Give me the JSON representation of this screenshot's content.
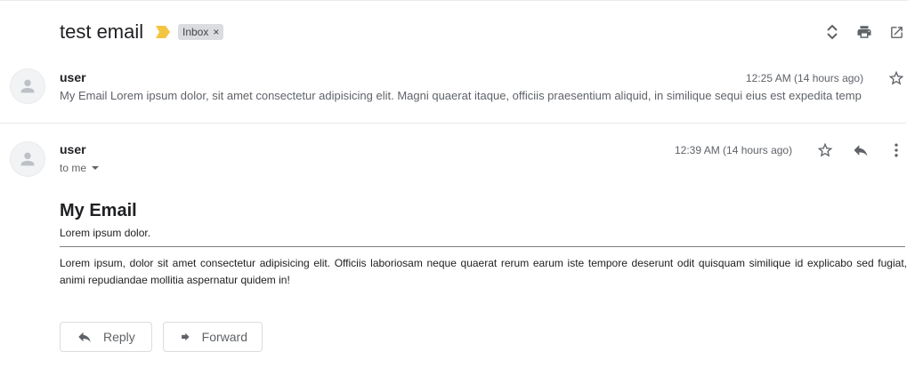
{
  "thread": {
    "subject": "test email",
    "label": "Inbox",
    "label_remove": "×"
  },
  "messages": [
    {
      "sender": "user",
      "snippet": "My Email Lorem ipsum dolor, sit amet consectetur adipisicing elit. Magni quaerat itaque, officiis praesentium aliquid, in similique sequi eius est expedita temp",
      "time": "12:25 AM (14 hours ago)"
    },
    {
      "sender": "user",
      "recipient": "to me",
      "time": "12:39 AM (14 hours ago)",
      "body_heading": "My Email",
      "body_subheading": "Lorem ipsum dolor.",
      "body_paragraph": "Lorem ipsum, dolor sit amet consectetur adipisicing elit. Officiis laboriosam neque quaerat rerum earum iste tempore deserunt odit quisquam similique id explicabo sed fugiat, animi repudiandae mollitia aspernatur quidem in!"
    }
  ],
  "actions": {
    "reply_label": "Reply",
    "forward_label": "Forward"
  },
  "icons": {
    "importance": "importance-marker-icon",
    "expand": "expand-all-icon",
    "print": "print-icon",
    "open_new": "open-in-new-window-icon",
    "star": "star-icon",
    "reply": "reply-icon",
    "more": "more-vert-icon",
    "avatar": "person-icon",
    "forward": "forward-icon"
  },
  "colors": {
    "importance": "#f4c542",
    "label_bg": "#dadce0",
    "icon": "#5f6368"
  }
}
